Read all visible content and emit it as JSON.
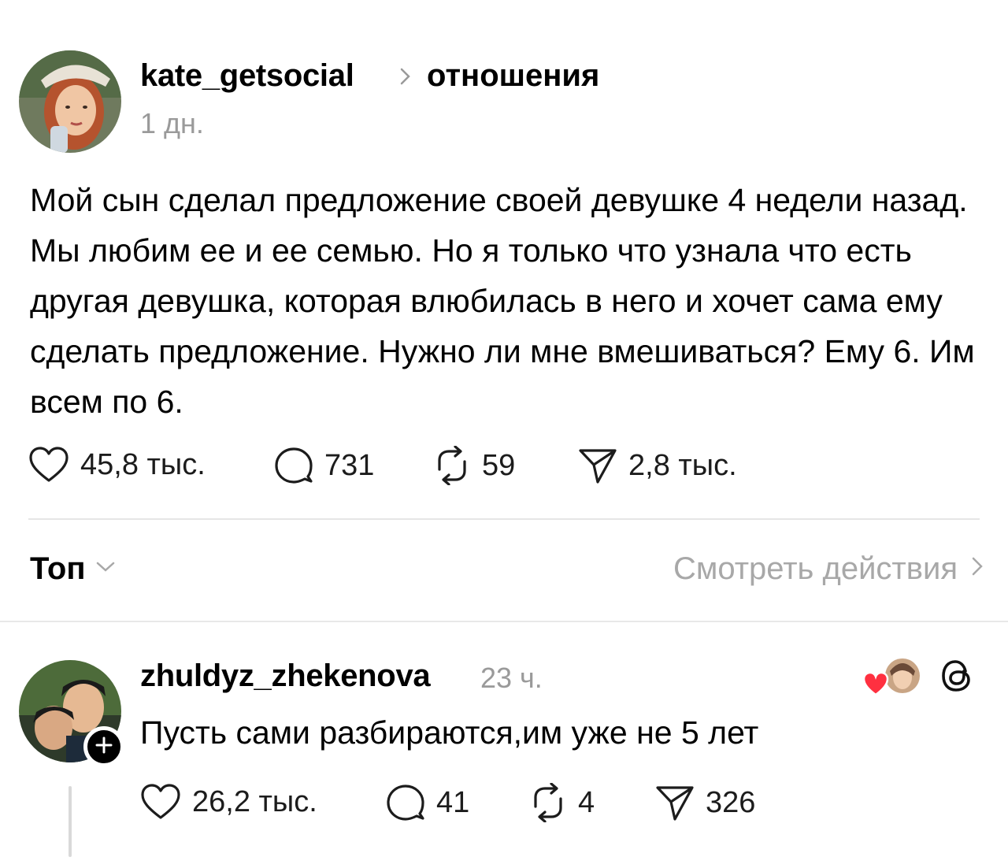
{
  "post": {
    "username": "kate_getsocial",
    "topic": "отношения",
    "time": "1 дн.",
    "text": "Мой сын сделал предложение своей девушке 4 недели назад. Мы любим ее и ее семью. Но я только что узнала что есть другая девушка, которая влюбилась в него и хочет сама ему сделать предложение. Нужно ли мне вмешиваться? Ему 6. Им всем по 6.",
    "likes": "45,8 тыс.",
    "comments": "731",
    "reposts": "59",
    "shares": "2,8 тыс."
  },
  "filter": {
    "label": "Топ",
    "view_activity": "Смотреть действия"
  },
  "reply": {
    "username": "zhuldyz_zhekenova",
    "time": "23 ч.",
    "text": "Пусть сами разбираются,им уже не 5 лет",
    "likes": "26,2 тыс.",
    "comments": "41",
    "reposts": "4",
    "shares": "326"
  },
  "icons": {
    "like": "heart-outline-icon",
    "comment": "speech-bubble-icon",
    "repost": "repost-icon",
    "share": "send-icon",
    "threads": "threads-logo-icon",
    "follow": "plus-icon",
    "liked_by_author": "heart-filled-icon"
  },
  "colors": {
    "text": "#000000",
    "muted": "#9a9a9a",
    "divider": "#e6e6e6",
    "heart_red": "#ff3040"
  }
}
